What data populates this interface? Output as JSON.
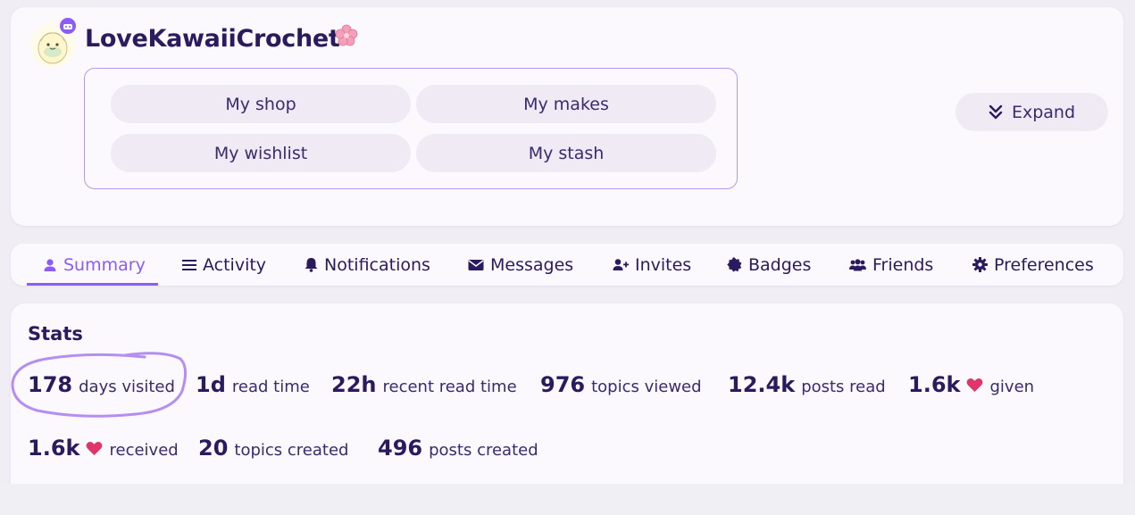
{
  "profile": {
    "username": "LoveKawaiiCrochet",
    "links": [
      "My shop",
      "My makes",
      "My wishlist",
      "My stash"
    ],
    "expand_label": "Expand"
  },
  "tabs": [
    {
      "label": "Summary",
      "icon": "user-icon",
      "active": true
    },
    {
      "label": "Activity",
      "icon": "list-icon"
    },
    {
      "label": "Notifications",
      "icon": "bell-icon"
    },
    {
      "label": "Messages",
      "icon": "envelope-icon"
    },
    {
      "label": "Invites",
      "icon": "user-plus-icon"
    },
    {
      "label": "Badges",
      "icon": "badge-icon"
    },
    {
      "label": "Friends",
      "icon": "users-icon"
    },
    {
      "label": "Preferences",
      "icon": "gear-icon"
    }
  ],
  "stats": {
    "title": "Stats",
    "items": [
      {
        "value": "178",
        "label": "days visited"
      },
      {
        "value": "1d",
        "label": "read time"
      },
      {
        "value": "22h",
        "label": "recent read time"
      },
      {
        "value": "976",
        "label": "topics viewed"
      },
      {
        "value": "12.4k",
        "label": "posts read"
      },
      {
        "value": "1.6k",
        "label": "given",
        "icon": "heart-icon"
      },
      {
        "value": "1.6k",
        "label": "received",
        "icon": "heart-icon"
      },
      {
        "value": "20",
        "label": "topics created"
      },
      {
        "value": "496",
        "label": "posts created"
      }
    ]
  },
  "colors": {
    "accent": "#8b5cf6",
    "text": "#2a1a5e",
    "heart": "#e0356a",
    "pill_bg": "#efeaf4"
  }
}
